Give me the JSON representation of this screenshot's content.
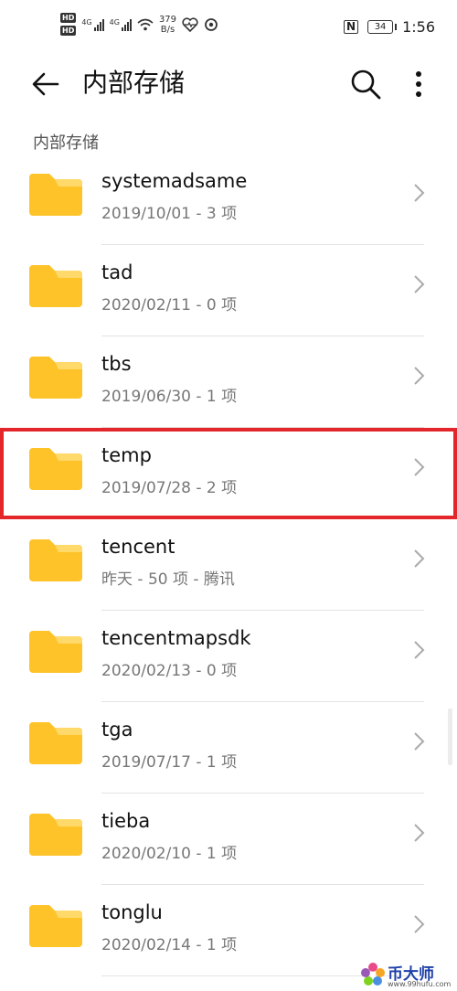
{
  "status_bar": {
    "hd1": "HD",
    "hd2": "HD",
    "net1": "4G",
    "net2": "4G",
    "speed_value": "379",
    "speed_unit": "B/s",
    "battery": "34",
    "time": "1:56"
  },
  "app_bar": {
    "title": "内部存储"
  },
  "breadcrumb": "内部存储",
  "colors": {
    "folder": "#ffc32a",
    "folder_tab": "#ffd96a",
    "highlight": "#e3262a"
  },
  "files": [
    {
      "name": "systemadsame",
      "meta": "2019/10/01 - 3 项"
    },
    {
      "name": "tad",
      "meta": "2020/02/11 - 0 项"
    },
    {
      "name": "tbs",
      "meta": "2019/06/30 - 1 项"
    },
    {
      "name": "temp",
      "meta": "2019/07/28 - 2 项"
    },
    {
      "name": "tencent",
      "meta": "昨天 - 50 项 - 腾讯"
    },
    {
      "name": "tencentmapsdk",
      "meta": "2020/02/13 - 0 项"
    },
    {
      "name": "tga",
      "meta": "2019/07/17 - 1 项"
    },
    {
      "name": "tieba",
      "meta": "2020/02/10 - 1 项"
    },
    {
      "name": "tonglu",
      "meta": "2020/02/14 - 1 项"
    }
  ],
  "watermark": {
    "text": "币大师",
    "url": "www.99hufu.com"
  }
}
